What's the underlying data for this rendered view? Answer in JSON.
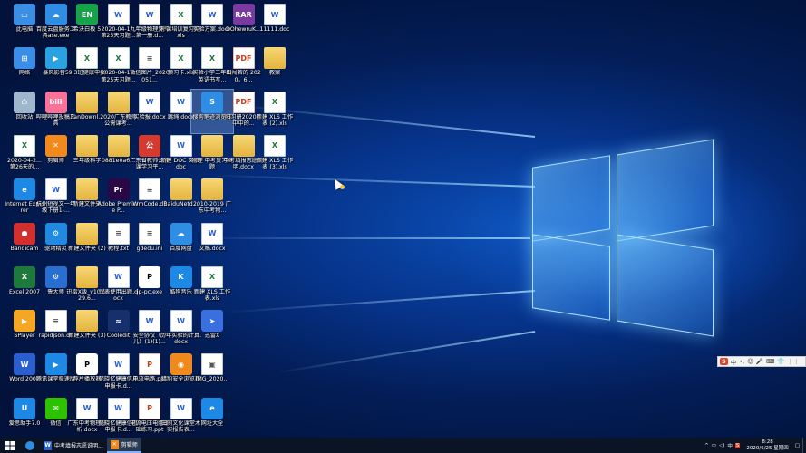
{
  "desktop": {
    "icons": [
      {
        "label": "此电脑",
        "icon": "this-pc-icon",
        "kind": "pc",
        "col": 0,
        "row": 0
      },
      {
        "label": "网络",
        "icon": "network-icon",
        "kind": "net",
        "col": 0,
        "row": 1
      },
      {
        "label": "回收站",
        "icon": "recycle-bin-icon",
        "kind": "bin",
        "col": 0,
        "row": 2
      },
      {
        "label": "2020-04-2... 第26天的...",
        "icon": "excel-file-icon",
        "kind": "xls",
        "col": 0,
        "row": 3
      },
      {
        "label": "Internet Explorer",
        "icon": "internet-explorer-icon",
        "kind": "ie",
        "col": 0,
        "row": 4
      },
      {
        "label": "Bandicam",
        "icon": "bandicam-icon",
        "kind": "band",
        "col": 0,
        "row": 5
      },
      {
        "label": "Excel 2007",
        "icon": "excel-2007-icon",
        "kind": "excelapp",
        "col": 0,
        "row": 6
      },
      {
        "label": "SPlayer",
        "icon": "splayer-icon",
        "kind": "splayer",
        "col": 0,
        "row": 7
      },
      {
        "label": "Word 2007",
        "icon": "word-2007-icon",
        "kind": "wordapp",
        "col": 0,
        "row": 8
      },
      {
        "label": "爱思助手7.0",
        "icon": "aisi-assistant-icon",
        "kind": "aisi",
        "col": 0,
        "row": 9
      },
      {
        "label": "百度云盘服务工具ase.exe",
        "icon": "baidu-cloud-icon",
        "kind": "bdcloud",
        "col": 1,
        "row": 0
      },
      {
        "label": "暴风影音5",
        "icon": "baofeng-icon",
        "kind": "baofeng",
        "col": 1,
        "row": 1
      },
      {
        "label": "哔哩哔哩投稿工具",
        "icon": "bilibili-icon",
        "kind": "bili",
        "col": 1,
        "row": 2
      },
      {
        "label": "剪辑师",
        "icon": "video-editor-icon",
        "kind": "jianji",
        "col": 1,
        "row": 3
      },
      {
        "label": "杭州短视文一年级下册1-...",
        "icon": "word-file-icon",
        "kind": "doc",
        "col": 1,
        "row": 4
      },
      {
        "label": "驱动精灵",
        "icon": "driver-genius-icon",
        "kind": "qudong",
        "col": 1,
        "row": 5
      },
      {
        "label": "鲁大师",
        "icon": "ludashi-icon",
        "kind": "ludashi",
        "col": 1,
        "row": 6
      },
      {
        "label": "rapidjson.dll",
        "icon": "dll-file-icon",
        "kind": "gen",
        "col": 1,
        "row": 7
      },
      {
        "label": "腾讯课堂极速版",
        "icon": "tencent-classroom-icon",
        "kind": "txkt",
        "col": 1,
        "row": 8
      },
      {
        "label": "微信",
        "icon": "wechat-icon",
        "kind": "wechat",
        "col": 1,
        "row": 9
      },
      {
        "label": "希沃白板 5",
        "icon": "seewo-icon",
        "kind": "seewo",
        "col": 2,
        "row": 0
      },
      {
        "label": "9.3班健康申报",
        "icon": "excel-file-icon",
        "kind": "xls",
        "col": 2,
        "row": 1
      },
      {
        "label": "PanDownl...",
        "icon": "folder-icon",
        "kind": "folder",
        "col": 2,
        "row": 2
      },
      {
        "label": "三年级科学",
        "icon": "folder-icon",
        "kind": "folder",
        "col": 2,
        "row": 3
      },
      {
        "label": "新建文件夹",
        "icon": "folder-icon",
        "kind": "folder",
        "col": 2,
        "row": 4
      },
      {
        "label": "新建文件夹 (2)",
        "icon": "folder-icon",
        "kind": "folder",
        "col": 2,
        "row": 5
      },
      {
        "label": "迅雷X版_v10.1.29.6...",
        "icon": "folder-icon",
        "kind": "folder",
        "col": 2,
        "row": 6
      },
      {
        "label": "新建文件夹 (3)",
        "icon": "folder-icon",
        "kind": "folder",
        "col": 2,
        "row": 7
      },
      {
        "label": "荐片播放器",
        "icon": "jianpian-icon",
        "kind": "jianpian",
        "col": 2,
        "row": 8
      },
      {
        "label": "广东中考物理分析.docx",
        "icon": "word-file-icon",
        "kind": "doc",
        "col": 2,
        "row": 9
      },
      {
        "label": "2020-04-1... 第25天习题...",
        "icon": "word-file-icon",
        "kind": "doc",
        "col": 3,
        "row": 0
      },
      {
        "label": "2020-04-1... 第25天习题...",
        "icon": "excel-file-icon",
        "kind": "xls",
        "col": 3,
        "row": 1
      },
      {
        "label": "2020广东教师公需课考...",
        "icon": "folder-icon",
        "kind": "folder",
        "col": 3,
        "row": 2
      },
      {
        "label": "0881e0a6...",
        "icon": "zip-file-icon",
        "kind": "folder",
        "col": 3,
        "row": 3
      },
      {
        "label": "Adobe Premiere P...",
        "icon": "premiere-icon",
        "kind": "premiere",
        "col": 3,
        "row": 4
      },
      {
        "label": "教程.txt",
        "icon": "text-file-icon",
        "kind": "gen",
        "col": 3,
        "row": 5
      },
      {
        "label": "仪表使用出题.docx",
        "icon": "word-file-icon",
        "kind": "doc",
        "col": 3,
        "row": 6
      },
      {
        "label": "Cooledit",
        "icon": "cooledit-icon",
        "kind": "cooledit",
        "col": 3,
        "row": 7
      },
      {
        "label": "范晓亿健康信息申报卡.d...",
        "icon": "word-file-icon",
        "kind": "doc",
        "col": 3,
        "row": 8
      },
      {
        "label": "范晓亿健康信息申报卡.d...",
        "icon": "word-file-icon",
        "kind": "doc",
        "col": 3,
        "row": 9
      },
      {
        "label": "九年级物理复习第一册.d...",
        "icon": "word-file-icon",
        "kind": "doc",
        "col": 4,
        "row": 0
      },
      {
        "label": "微信图片_2020051...",
        "icon": "image-file-icon",
        "kind": "gen",
        "col": 4,
        "row": 1
      },
      {
        "label": "实验报.docx",
        "icon": "word-file-icon",
        "kind": "doc",
        "col": 4,
        "row": 2
      },
      {
        "label": "广东省教师公需课学习平...",
        "icon": "guangdong-edu-icon",
        "kind": "gdedu",
        "col": 4,
        "row": 3
      },
      {
        "label": "WmCode.dll",
        "icon": "dll-file-icon",
        "kind": "gen",
        "col": 4,
        "row": 4
      },
      {
        "label": "gdedu.ini",
        "icon": "ini-file-icon",
        "kind": "gen",
        "col": 4,
        "row": 5
      },
      {
        "label": "jp-pc.exe",
        "icon": "jp-pc-icon",
        "kind": "jp",
        "col": 4,
        "row": 6
      },
      {
        "label": "安全协议（少儿）(1)(1)...",
        "icon": "word-file-icon",
        "kind": "doc",
        "col": 4,
        "row": 7
      },
      {
        "label": "电流电路.ppt",
        "icon": "ppt-file-icon",
        "kind": "ppt",
        "col": 4,
        "row": 8
      },
      {
        "label": "电流电压电阻基础练习.ppt",
        "icon": "ppt-file-icon",
        "kind": "ppt",
        "col": 4,
        "row": 9
      },
      {
        "label": "补课培训复习作.xls",
        "icon": "excel-file-icon",
        "kind": "xls",
        "col": 5,
        "row": 0
      },
      {
        "label": "预习卡.xls",
        "icon": "excel-file-icon",
        "kind": "xls",
        "col": 5,
        "row": 1
      },
      {
        "label": "跳绳.docx",
        "icon": "word-file-icon",
        "kind": "doc",
        "col": 5,
        "row": 2
      },
      {
        "label": "新建 DOC 文档.doc",
        "icon": "word-file-icon",
        "kind": "doc",
        "col": 5,
        "row": 3
      },
      {
        "label": "BaiduNetd...",
        "icon": "baidu-netdisk-icon",
        "kind": "folder",
        "col": 5,
        "row": 4
      },
      {
        "label": "百度网盘",
        "icon": "baidu-netdisk-app-icon",
        "kind": "bdpan",
        "col": 5,
        "row": 5
      },
      {
        "label": "酷狗音乐",
        "icon": "kugou-icon",
        "kind": "kugou",
        "col": 5,
        "row": 6
      },
      {
        "label": "历年实验的计算.docx",
        "icon": "word-file-icon",
        "kind": "doc",
        "col": 5,
        "row": 7
      },
      {
        "label": "猎豹安全浏览器",
        "icon": "liebao-browser-icon",
        "kind": "liebao",
        "col": 5,
        "row": 8
      },
      {
        "label": "田间文化课堂术实报告表...",
        "icon": "word-file-icon",
        "kind": "doc",
        "col": 5,
        "row": 9
      },
      {
        "label": "实验方案.docx",
        "icon": "word-file-icon",
        "kind": "doc",
        "col": 6,
        "row": 0
      },
      {
        "label": "实验小学三年级英语书写...",
        "icon": "excel-file-icon",
        "kind": "xls",
        "col": 6,
        "row": 1
      },
      {
        "label": "搜狗笔迹浏览器",
        "icon": "sogou-browser-icon",
        "kind": "sogou",
        "col": 6,
        "row": 2,
        "selected": true
      },
      {
        "label": "物理 中考复习出题",
        "icon": "word-file-icon",
        "kind": "folder",
        "col": 6,
        "row": 3
      },
      {
        "label": "2010-2019 广东中考物...",
        "icon": "folder-icon",
        "kind": "folder",
        "col": 6,
        "row": 4
      },
      {
        "label": "文稿.docx",
        "icon": "word-file-icon",
        "kind": "doc",
        "col": 6,
        "row": 5
      },
      {
        "label": "新建 XLS 工作表.xls",
        "icon": "excel-file-icon",
        "kind": "xls",
        "col": 6,
        "row": 6
      },
      {
        "label": "迅雷X",
        "icon": "xunlei-icon",
        "kind": "xunlei",
        "col": 6,
        "row": 7
      },
      {
        "label": "IMG_2020...",
        "icon": "image-file-icon",
        "kind": "img",
        "col": 6,
        "row": 8
      },
      {
        "label": "网址大全",
        "icon": "ie-link-icon",
        "kind": "ie",
        "col": 6,
        "row": 9
      },
      {
        "label": "DOhewruK...",
        "icon": "winrar-icon",
        "kind": "winrar",
        "col": 7,
        "row": 0
      },
      {
        "label": "出闯若的 2020，6...",
        "icon": "pdf-file-icon",
        "kind": "pdf",
        "col": 7,
        "row": 1
      },
      {
        "label": "阳习册2020年中中的...",
        "icon": "pdf-file-icon",
        "kind": "pdf",
        "col": 7,
        "row": 2
      },
      {
        "label": "中考填报志愿说明.docx",
        "icon": "folder-icon",
        "kind": "folder",
        "col": 7,
        "row": 3
      },
      {
        "label": "11111.doc",
        "icon": "word-file-icon",
        "kind": "doc",
        "col": 8,
        "row": 0
      },
      {
        "label": "教案",
        "icon": "folder-icon",
        "kind": "folder",
        "col": 8,
        "row": 1
      },
      {
        "label": "新建 XLS 工作表 (2).xls",
        "icon": "excel-file-icon",
        "kind": "xls",
        "col": 8,
        "row": 2
      },
      {
        "label": "新建 XLS 工作表 (3).xls",
        "icon": "excel-file-icon",
        "kind": "xls",
        "col": 8,
        "row": 3
      }
    ]
  },
  "ime_bar": {
    "brand": "S",
    "mode": "中",
    "items": [
      "•,",
      "☺",
      "🎤",
      "⌨",
      "👕",
      "⋮⋮"
    ]
  },
  "taskbar": {
    "start_icon": "windows-start-icon",
    "tasks": [
      {
        "label": "",
        "icon": "sogou-browser-icon",
        "active": false
      },
      {
        "label": "中考填报志愿说明...",
        "icon": "word-file-icon",
        "active": false
      },
      {
        "label": "剪辑师",
        "icon": "video-editor-icon",
        "active": true
      }
    ],
    "tray": {
      "chevron": "^",
      "time": "8:28",
      "date": "2020/6/25 星期四"
    }
  },
  "colors": {
    "wallpaper_dark": "#02123a",
    "wallpaper_mid": "#0b4fb6",
    "taskbar": "#0b1424",
    "word_blue": "#2b5fd0",
    "excel_green": "#1e7a3a",
    "folder_yellow": "#e4b33d"
  }
}
